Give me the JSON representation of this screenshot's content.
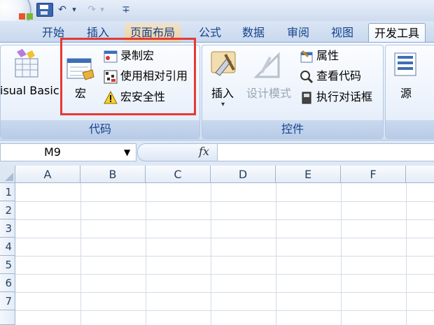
{
  "quick_access": {
    "undo_symbol": "↶",
    "redo_symbol": "↷",
    "dropdown_symbol": "▾",
    "customize_symbol": "∓"
  },
  "tabs": [
    "开始",
    "插入",
    "页面布局",
    "公式",
    "数据",
    "审阅",
    "视图",
    "开发工具"
  ],
  "active_tab": "开发工具",
  "ribbon": {
    "visual_basic_label": "isual Basic",
    "macro_label": "宏",
    "record_macro": "录制宏",
    "relative_ref": "使用相对引用",
    "macro_security": "宏安全性",
    "code_group": "代码",
    "insert_label": "插入",
    "design_mode": "设计模式",
    "properties": "属性",
    "view_code": "查看代码",
    "run_dialog": "执行对话框",
    "controls_group": "控件",
    "source_label": "源"
  },
  "formula_bar": {
    "name_box": "M9",
    "fx": "fx",
    "formula": ""
  },
  "sheet": {
    "columns": [
      "A",
      "B",
      "C",
      "D",
      "E",
      "F"
    ],
    "rows": [
      "1",
      "2",
      "3",
      "4",
      "5",
      "6",
      "7"
    ]
  },
  "colors": {
    "highlight": "#e53935",
    "tab_text": "#15428b"
  }
}
